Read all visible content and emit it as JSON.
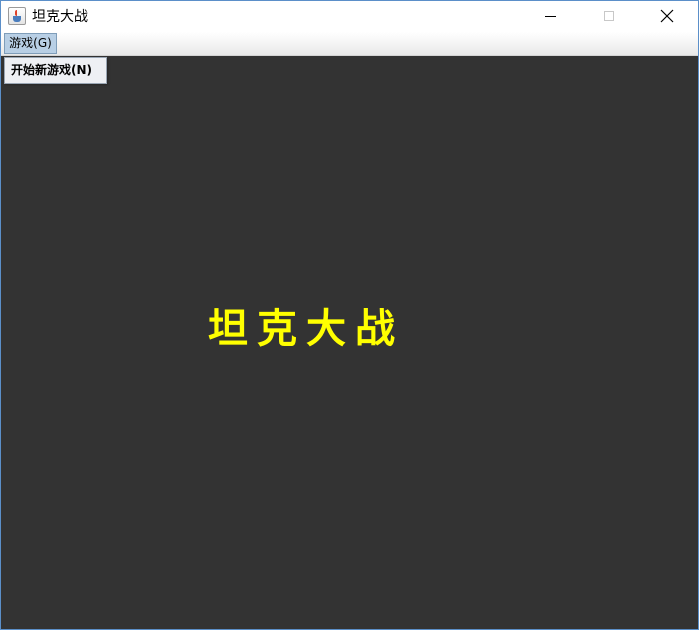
{
  "window": {
    "title": "坦克大战",
    "icon": "java-cup-icon"
  },
  "menubar": {
    "items": [
      {
        "label": "游戏(G)"
      }
    ]
  },
  "dropdown": {
    "items": [
      {
        "label": "开始新游戏(N)"
      }
    ]
  },
  "canvas": {
    "title": "坦克大战",
    "background": "#333333",
    "title_color": "#ffff00"
  }
}
